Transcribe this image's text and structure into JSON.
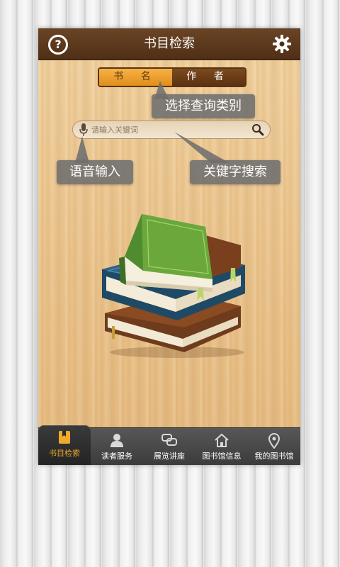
{
  "header": {
    "title": "书目检索",
    "help_icon": "help-icon",
    "settings_icon": "gear-icon"
  },
  "search_type": {
    "options": [
      "书 名",
      "作 者"
    ],
    "selected": "书 名"
  },
  "search": {
    "placeholder": "请输入关键词",
    "value": ""
  },
  "callouts": {
    "select_type": "选择查询类别",
    "voice_input": "语音输入",
    "keyword_search": "关键字搜索"
  },
  "tabs": [
    {
      "label": "书目检索",
      "icon": "book-icon",
      "active": true
    },
    {
      "label": "读者服务",
      "icon": "person-icon",
      "active": false
    },
    {
      "label": "展览讲座",
      "icon": "chat-icon",
      "active": false
    },
    {
      "label": "图书馆信息",
      "icon": "home-icon",
      "active": false
    },
    {
      "label": "我的图书馆",
      "icon": "location-pin-icon",
      "active": false
    }
  ],
  "colors": {
    "accent": "#f0a92c",
    "header_bg": "#5a381c",
    "wood": "#e9c28a"
  }
}
